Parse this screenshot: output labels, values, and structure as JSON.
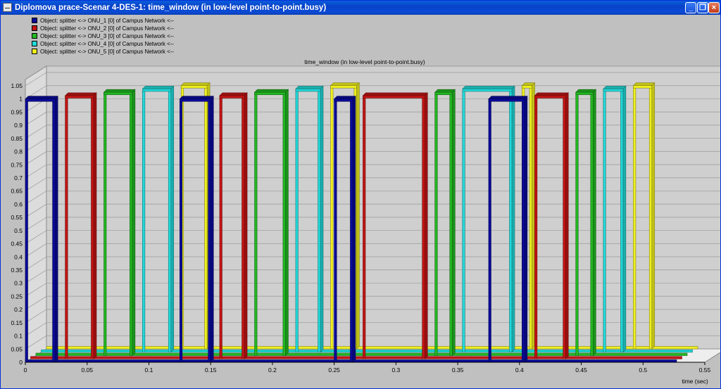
{
  "window": {
    "title": "Diplomova prace-Scenar 4-DES-1: time_window (in low-level point-to-point.busy)",
    "buttons": [
      "minimize",
      "restore",
      "close"
    ]
  },
  "colors": {
    "background": "#c0c0c0",
    "plot_floor": "#eeeeee",
    "plot_wall": "#cfcfcf"
  },
  "legend": [
    {
      "label": "Object: splitter <-> ONU_1 [0] of Campus Network <--",
      "color": "#0a0a9a"
    },
    {
      "label": "Object: splitter <-> ONU_2 [0] of Campus Network <--",
      "color": "#c21414"
    },
    {
      "label": "Object: splitter <-> ONU_3 [0] of Campus Network <--",
      "color": "#22b822"
    },
    {
      "label": "Object: splitter <-> ONU_4 [0] of Campus Network <--",
      "color": "#22d8d8"
    },
    {
      "label": "Object: splitter <-> ONU_5 [0] of Campus Network <--",
      "color": "#f0f020"
    }
  ],
  "chart_data": {
    "type": "line",
    "title": "time_window (in low-level point-to-point.busy)",
    "xlabel": "time (sec)",
    "ylabel": "",
    "xlim": [
      0,
      0.55
    ],
    "ylim": [
      0,
      1.05
    ],
    "x_ticks": [
      "0",
      "0.05",
      "0.1",
      "0.15",
      "0.2",
      "0.25",
      "0.3",
      "0.35",
      "0.4",
      "0.45",
      "0.5",
      "0.55"
    ],
    "y_ticks": [
      "0",
      "0.05",
      "0.1",
      "0.15",
      "0.2",
      "0.25",
      "0.3",
      "0.35",
      "0.4",
      "0.45",
      "0.5",
      "0.55",
      "0.6",
      "0.65",
      "0.7",
      "0.75",
      "0.8",
      "0.85",
      "0.9",
      "0.95",
      "1",
      "1.05"
    ],
    "grid": true,
    "legend_position": "top-left",
    "style": "3d-step",
    "series": [
      {
        "name": "Object: splitter <-> ONU_1 [0] of Campus Network <--",
        "color": "#0a0a9a",
        "busy_intervals": [
          [
            0.0,
            0.024
          ],
          [
            0.125,
            0.15
          ],
          [
            0.25,
            0.265
          ],
          [
            0.375,
            0.404
          ]
        ]
      },
      {
        "name": "Object: splitter <-> ONU_2 [0] of Campus Network <--",
        "color": "#c21414",
        "busy_intervals": [
          [
            0.028,
            0.051
          ],
          [
            0.153,
            0.173
          ],
          [
            0.269,
            0.319
          ],
          [
            0.408,
            0.433
          ]
        ]
      },
      {
        "name": "Object: splitter <-> ONU_3 [0] of Campus Network <--",
        "color": "#22b822",
        "busy_intervals": [
          [
            0.055,
            0.078
          ],
          [
            0.177,
            0.202
          ],
          [
            0.323,
            0.337
          ],
          [
            0.437,
            0.451
          ]
        ]
      },
      {
        "name": "Object: splitter <-> ONU_4 [0] of Campus Network <--",
        "color": "#22d8d8",
        "busy_intervals": [
          [
            0.082,
            0.105
          ],
          [
            0.206,
            0.226
          ],
          [
            0.341,
            0.381
          ],
          [
            0.455,
            0.471
          ]
        ]
      },
      {
        "name": "Object: splitter <-> ONU_5 [0] of Campus Network <--",
        "color": "#f0f020",
        "busy_intervals": [
          [
            0.109,
            0.13
          ],
          [
            0.23,
            0.251
          ],
          [
            0.385,
            0.393
          ],
          [
            0.475,
            0.49
          ]
        ]
      }
    ]
  }
}
